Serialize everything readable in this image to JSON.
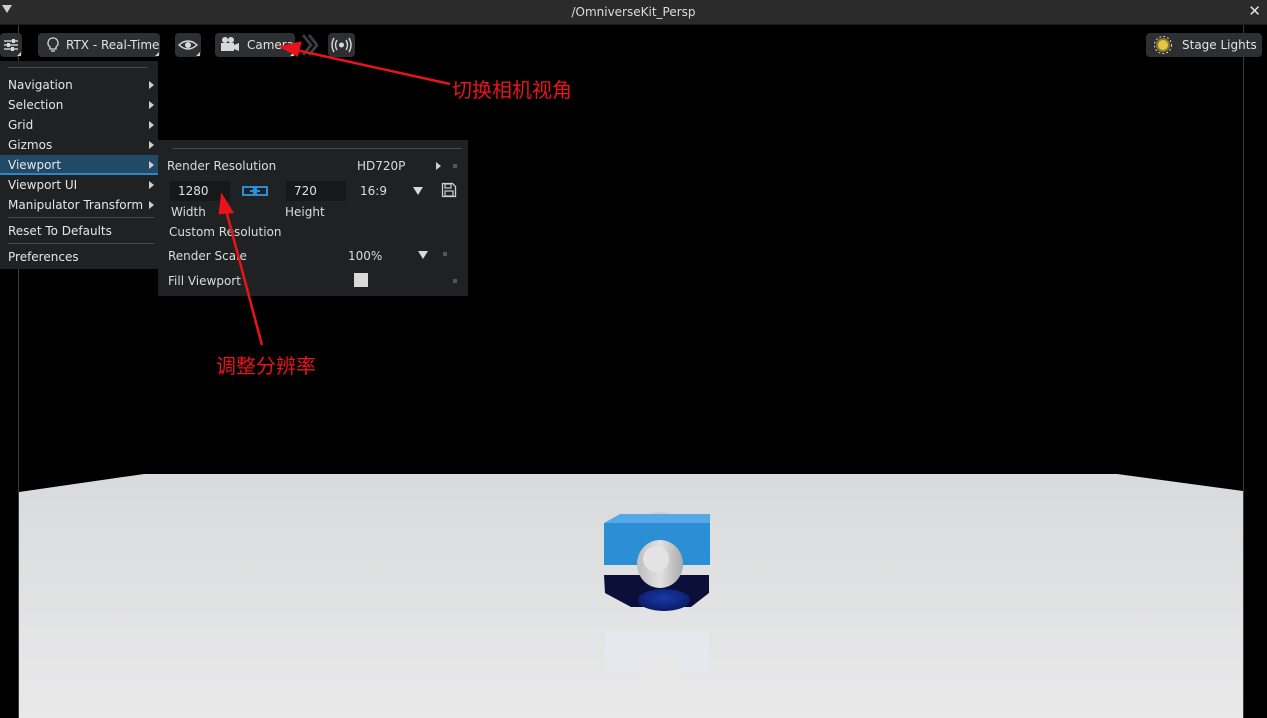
{
  "window": {
    "title": "/OmniverseKit_Persp"
  },
  "toolbar": {
    "renderer_label": "RTX - Real-Time",
    "camera_label": "Camera",
    "stage_lights_label": "Stage Lights"
  },
  "settings_menu": {
    "items": [
      {
        "label": "Navigation",
        "submenu": true
      },
      {
        "label": "Selection",
        "submenu": true
      },
      {
        "label": "Grid",
        "submenu": true
      },
      {
        "label": "Gizmos",
        "submenu": true
      },
      {
        "label": "Viewport",
        "submenu": true,
        "active": true
      },
      {
        "label": "Viewport UI",
        "submenu": true
      },
      {
        "label": "Manipulator Transform",
        "submenu": true
      },
      {
        "label": "Reset To Defaults",
        "submenu": false
      },
      {
        "label": "Preferences",
        "submenu": false
      }
    ]
  },
  "viewport_submenu": {
    "render_resolution_label": "Render Resolution",
    "preset_value": "HD720P",
    "width_value": "1280",
    "width_label": "Width",
    "height_value": "720",
    "height_label": "Height",
    "aspect_ratio_value": "16:9",
    "custom_resolution_label": "Custom Resolution",
    "render_scale_label": "Render Scale",
    "render_scale_value": "100%",
    "fill_viewport_label": "Fill Viewport",
    "fill_viewport_checked": false
  },
  "annotations": {
    "camera_note": "切换相机视角",
    "resolution_note": "调整分辨率"
  },
  "colors": {
    "accent_blue": "#2b8fd6",
    "annotation_red": "#e8141b",
    "menu_bg": "#1f2123",
    "menu_highlight": "#224a66"
  }
}
